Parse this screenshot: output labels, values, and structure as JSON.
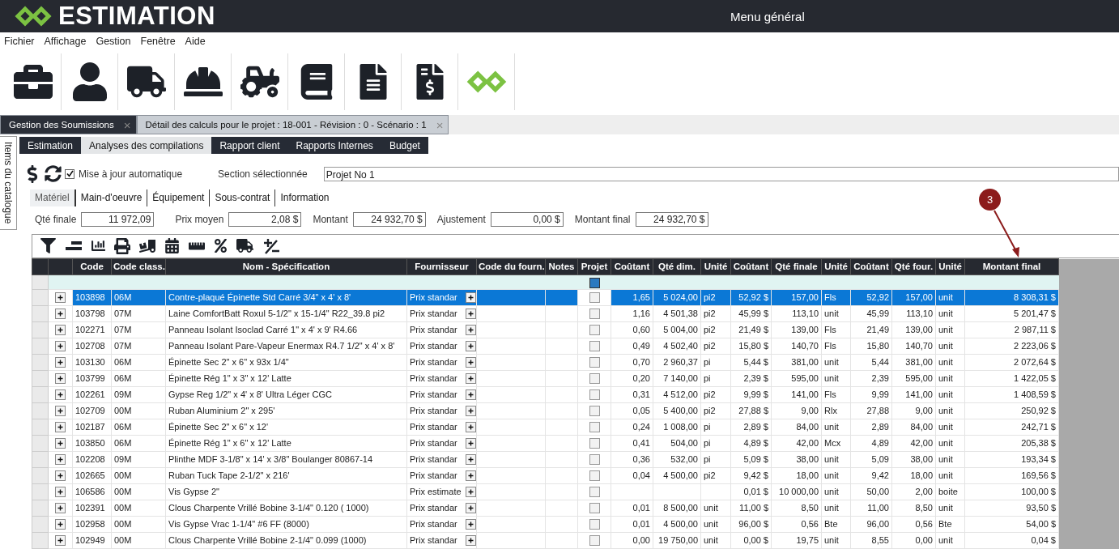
{
  "app": {
    "logo_text": "ESTIMATION",
    "title": "Menu général"
  },
  "menu": [
    "Fichier",
    "Affichage",
    "Gestion",
    "Fenêtre",
    "Aide"
  ],
  "doc_tabs": [
    {
      "label": "Gestion des Soumissions",
      "selected": false,
      "close": "×"
    },
    {
      "label": "Détail des calculs pour le projet : 18-001 - Révision : 0 - Scénario : 1",
      "selected": true,
      "close": "×"
    }
  ],
  "side_tab": {
    "label": "Items du catalogue"
  },
  "view_tabs": [
    {
      "label": "Estimation",
      "selected": false
    },
    {
      "label": "Analyses des compilations",
      "selected": true
    },
    {
      "label": "Rapport client",
      "selected": false
    },
    {
      "label": "Rapports Internes",
      "selected": false
    },
    {
      "label": "Budget",
      "selected": false
    }
  ],
  "auto_update": {
    "label": "Mise à jour automatique",
    "checked": true
  },
  "section": {
    "label": "Section sélectionnée",
    "value": "Projet No 1"
  },
  "category_tabs": [
    {
      "label": "Matériel",
      "selected": true
    },
    {
      "label": "Main-d'oeuvre",
      "selected": false
    },
    {
      "label": "Équipement",
      "selected": false
    },
    {
      "label": "Sous-contrat",
      "selected": false
    },
    {
      "label": "Information",
      "selected": false
    }
  ],
  "summary": [
    {
      "label": "Qté finale",
      "value": "11 972,09"
    },
    {
      "label": "Prix moyen",
      "value": "2,08 $"
    },
    {
      "label": "Montant",
      "value": "24 932,70 $"
    },
    {
      "label": "Ajustement",
      "value": "0,00 $"
    },
    {
      "label": "Montant final",
      "value": "24 932,70 $"
    }
  ],
  "annotation": {
    "label": "3"
  },
  "grid": {
    "filter": {
      "projet_checked": true
    },
    "columns": [
      "Code",
      "Code class.",
      "Nom - Spécification",
      "Fournisseur",
      "Code du fourn.",
      "Notes",
      "Projet",
      "Coûtant",
      "Qté dim.",
      "Unité",
      "Coûtant",
      "Qté finale",
      "Unité",
      "Coûtant",
      "Qté four.",
      "Unité",
      "Montant final"
    ],
    "rows": [
      {
        "selected": true,
        "projet": false,
        "cells": [
          "103898",
          "06M",
          "Contre-plaqué Épinette Std Carré 3/4\" x 4' x 8'",
          "Prix standar",
          "",
          "",
          "",
          "1,65",
          "5 024,00",
          "pi2",
          "52,92 $",
          "157,00",
          "Fls",
          "52,92",
          "157,00",
          "unit",
          "8 308,31 $"
        ]
      },
      {
        "selected": false,
        "projet": false,
        "cells": [
          "103798",
          "07M",
          "Laine ComfortBatt Roxul  5-1/2\" x 15-1/4\" R22_39.8 pi2",
          "Prix standar",
          "",
          "",
          "",
          "1,16",
          "4 501,38",
          "pi2",
          "45,99 $",
          "113,10",
          "unit",
          "45,99",
          "113,10",
          "unit",
          "5 201,47 $"
        ]
      },
      {
        "selected": false,
        "projet": false,
        "cells": [
          "102271",
          "07M",
          "Panneau Isolant Isoclad Carré 1\" x 4' x 9' R4.66",
          "Prix standar",
          "",
          "",
          "",
          "0,60",
          "5 004,00",
          "pi2",
          "21,49 $",
          "139,00",
          "Fls",
          "21,49",
          "139,00",
          "unit",
          "2 987,11 $"
        ]
      },
      {
        "selected": false,
        "projet": false,
        "cells": [
          "102708",
          "07M",
          "Panneau Isolant Pare-Vapeur Enermax R4.7 1/2\" x 4' x 8'",
          "Prix standar",
          "",
          "",
          "",
          "0,49",
          "4 502,40",
          "pi2",
          "15,80 $",
          "140,70",
          "Fls",
          "15,80",
          "140,70",
          "unit",
          "2 223,06 $"
        ]
      },
      {
        "selected": false,
        "projet": false,
        "cells": [
          "103130",
          "06M",
          "Épinette Sec  2\" x  6\" x    93x 1/4\"",
          "Prix standar",
          "",
          "",
          "",
          "0,70",
          "2 960,37",
          "pi",
          "5,44 $",
          "381,00",
          "unit",
          "5,44",
          "381,00",
          "unit",
          "2 072,64 $"
        ]
      },
      {
        "selected": false,
        "projet": false,
        "cells": [
          "103799",
          "06M",
          "Épinette Rég   1\" x  3\" x 12' Latte",
          "Prix standar",
          "",
          "",
          "",
          "0,20",
          "7 140,00",
          "pi",
          "2,39 $",
          "595,00",
          "unit",
          "2,39",
          "595,00",
          "unit",
          "1 422,05 $"
        ]
      },
      {
        "selected": false,
        "projet": false,
        "cells": [
          "102261",
          "09M",
          "Gypse Reg 1/2\" x 4' x  8' Ultra Léger CGC",
          "Prix standar",
          "",
          "",
          "",
          "0,31",
          "4 512,00",
          "pi2",
          "9,99 $",
          "141,00",
          "Fls",
          "9,99",
          "141,00",
          "unit",
          "1 408,59 $"
        ]
      },
      {
        "selected": false,
        "projet": false,
        "cells": [
          "102709",
          "00M",
          "Ruban Aluminium 2\" x 295'",
          "Prix standar",
          "",
          "",
          "",
          "0,05",
          "5 400,00",
          "pi2",
          "27,88 $",
          "9,00",
          "Rlx",
          "27,88",
          "9,00",
          "unit",
          "250,92 $"
        ]
      },
      {
        "selected": false,
        "projet": false,
        "cells": [
          "102187",
          "06M",
          "Épinette Sec  2\" x  6\" x 12'",
          "Prix standar",
          "",
          "",
          "",
          "0,24",
          "1 008,00",
          "pi",
          "2,89 $",
          "84,00",
          "unit",
          "2,89",
          "84,00",
          "unit",
          "242,71 $"
        ]
      },
      {
        "selected": false,
        "projet": false,
        "cells": [
          "103850",
          "06M",
          "Épinette Rég   1\" x  6\" x 12' Latte",
          "Prix standar",
          "",
          "",
          "",
          "0,41",
          "504,00",
          "pi",
          "4,89 $",
          "42,00",
          "Mcx",
          "4,89",
          "42,00",
          "unit",
          "205,38 $"
        ]
      },
      {
        "selected": false,
        "projet": false,
        "cells": [
          "102208",
          "09M",
          "Plinthe MDF  3-1/8\" x 14' x 3/8\" Boulanger 80867-14",
          "Prix standar",
          "",
          "",
          "",
          "0,36",
          "532,00",
          "pi",
          "5,09 $",
          "38,00",
          "unit",
          "5,09",
          "38,00",
          "unit",
          "193,34 $"
        ]
      },
      {
        "selected": false,
        "projet": false,
        "cells": [
          "102665",
          "00M",
          "Ruban Tuck Tape 2-1/2\" x 216'",
          "Prix standar",
          "",
          "",
          "",
          "0,04",
          "4 500,00",
          "pi2",
          "9,42 $",
          "18,00",
          "unit",
          "9,42",
          "18,00",
          "unit",
          "169,56 $"
        ]
      },
      {
        "selected": false,
        "projet": false,
        "cells": [
          "106586",
          "00M",
          "Vis Gypse 2\"",
          "Prix estimate",
          "",
          "",
          "",
          "",
          "",
          "",
          "0,01 $",
          "10 000,00",
          "unit",
          "50,00",
          "2,00",
          "boite",
          "100,00 $"
        ]
      },
      {
        "selected": false,
        "projet": false,
        "cells": [
          "102391",
          "00M",
          "Clous Charpente Vrillé Bobine 3-1/4\" 0.120 ( 1000)",
          "Prix standar",
          "",
          "",
          "",
          "0,01",
          "8 500,00",
          "unit",
          "11,00 $",
          "8,50",
          "unit",
          "11,00",
          "8,50",
          "unit",
          "93,50 $"
        ]
      },
      {
        "selected": false,
        "projet": false,
        "cells": [
          "102958",
          "00M",
          "Vis Gypse Vrac 1-1/4\" #6 FF (8000)",
          "Prix standar",
          "",
          "",
          "",
          "0,01",
          "4 500,00",
          "unit",
          "96,00 $",
          "0,56",
          "Bte",
          "96,00",
          "0,56",
          "Bte",
          "54,00 $"
        ]
      },
      {
        "selected": false,
        "projet": false,
        "cells": [
          "102949",
          "00M",
          "Clous Charpente Vrillé Bobine 2-1/4\" 0.099 (1000)",
          "Prix standar",
          "",
          "",
          "",
          "0,00",
          "19 750,00",
          "unit",
          "0,00 $",
          "19,75",
          "unit",
          "8,55",
          "0,00",
          "unit",
          "0,04 $"
        ]
      }
    ]
  }
}
